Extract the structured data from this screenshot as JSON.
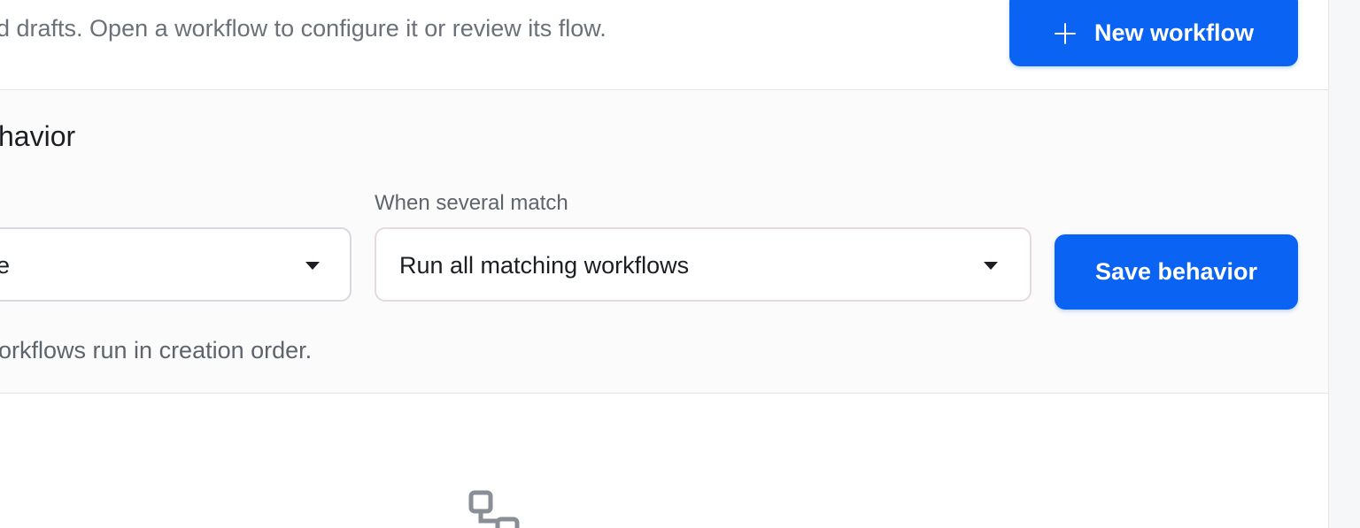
{
  "header": {
    "description": "d drafts. Open a workflow to configure it or review its flow.",
    "new_workflow_label": "New workflow"
  },
  "behavior": {
    "title": "havior",
    "first_select_value": "e",
    "when_several_match_label": "When several match",
    "when_several_match_value": "Run all matching workflows",
    "save_label": "Save behavior",
    "help_text": "orkflows run in creation order."
  },
  "icons": {
    "new_workflow": "plus-icon",
    "select_caret": "caret-down-icon",
    "empty_state": "workflow-icon"
  },
  "colors": {
    "primary": "#0b63f3",
    "muted_text": "#6b7079"
  }
}
